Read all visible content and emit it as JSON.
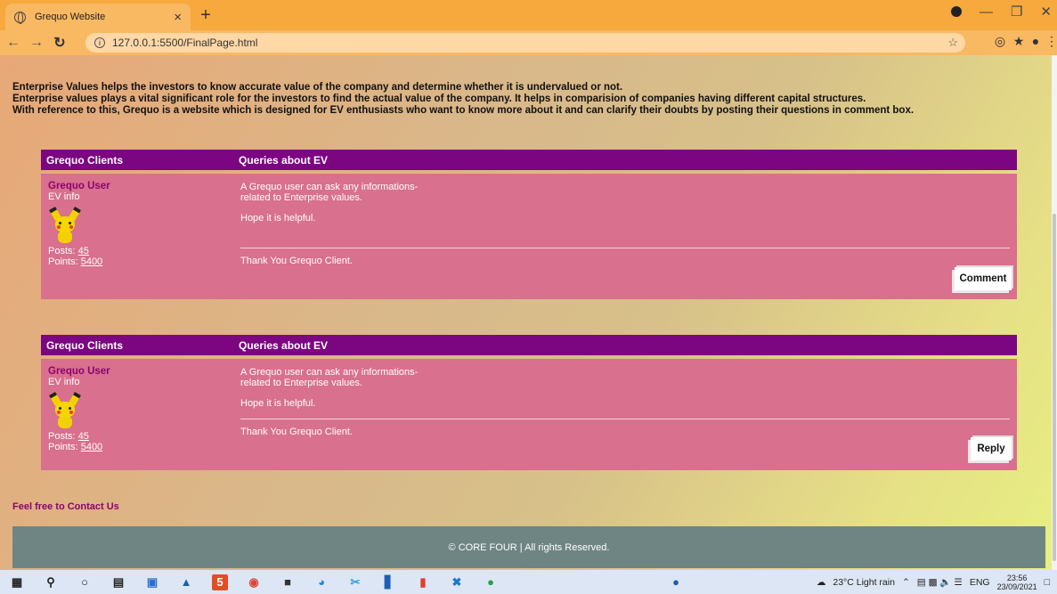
{
  "browser": {
    "tab_title": "Grequo Website",
    "tab_close": "×",
    "new_tab": "+",
    "url": "127.0.0.1:5500/FinalPage.html"
  },
  "intro": {
    "line1": "Enterprise Values helps the investors to know accurate value of the company and determine whether it is undervalued or not.",
    "line2": "Enterprise values plays a vital significant role for the investors to find the actual value of the company. It helps in comparision of companies having different capital structures.",
    "line3": "With reference to this, Grequo is a website which is designed for EV enthusiasts who want to know more about it and can clarify their doubts by posting their questions in comment box."
  },
  "forums": [
    {
      "col1": "Grequo Clients",
      "col2": "Queries about EV",
      "user_name": "Grequo User",
      "user_role": "EV info",
      "posts_label": "Posts:",
      "posts": "45",
      "points_label": "Points:",
      "points": "5400",
      "msg_line1": "A Grequo user can ask any informations-",
      "msg_line2": "related to Enterprise values.",
      "msg_line3": "Hope it is helpful.",
      "signature": "Thank You Grequo Client.",
      "button": "Comment"
    },
    {
      "col1": "Grequo Clients",
      "col2": "Queries about EV",
      "user_name": "Grequo User",
      "user_role": "EV info",
      "posts_label": "Posts:",
      "posts": "45",
      "points_label": "Points:",
      "points": "5400",
      "msg_line1": "A Grequo user can ask any informations-",
      "msg_line2": "related to Enterprise values.",
      "msg_line3": "Hope it is helpful.",
      "signature": "Thank You Grequo Client.",
      "button": "Reply"
    }
  ],
  "contact": "Feel free to Contact Us",
  "footer": "© CORE FOUR | All rights Reserved.",
  "taskbar": {
    "weather": "23°C  Light rain",
    "lang": "ENG",
    "time": "23:56",
    "date": "23/09/2021"
  },
  "colors": {
    "forum_header": "#7c0582",
    "forum_body": "#d9708d",
    "footer": "#6f8584",
    "tabbar": "#f7a93e"
  }
}
